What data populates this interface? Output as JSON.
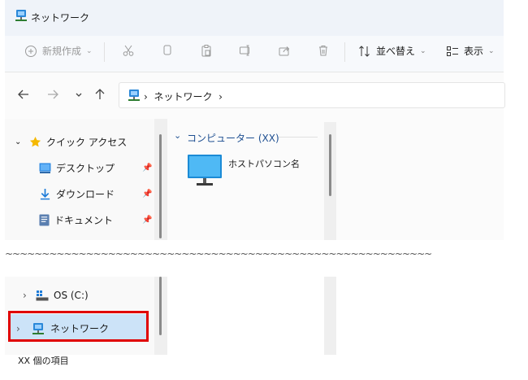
{
  "window": {
    "title": "ネットワーク"
  },
  "toolbar": {
    "new_label": "新規作成",
    "sort_label": "並べ替え",
    "view_label": "表示"
  },
  "address": {
    "path": "ネットワーク"
  },
  "sidebar": {
    "quick_access": "クイック アクセス",
    "items": [
      {
        "label": "デスクトップ",
        "icon": "desktop-icon"
      },
      {
        "label": "ダウンロード",
        "icon": "download-icon"
      },
      {
        "label": "ドキュメント",
        "icon": "document-icon"
      }
    ],
    "drive_label": "OS (C:)",
    "network_label": "ネットワーク"
  },
  "content": {
    "group_header": "コンピューター (XX)",
    "items": [
      {
        "label": "ホストパソコン名",
        "icon": "monitor-icon"
      }
    ]
  },
  "separator_text": "~~~~~~~~~~~~~~~~~~~~~~~~~~~~~~~~~~~~~~~~~~~~~~~~~~~~~~~~~~",
  "status": {
    "item_count": "XX 個の項目"
  },
  "colors": {
    "accent": "#1e4f91",
    "selection": "#cce3f8",
    "highlight_border": "#e00000"
  }
}
